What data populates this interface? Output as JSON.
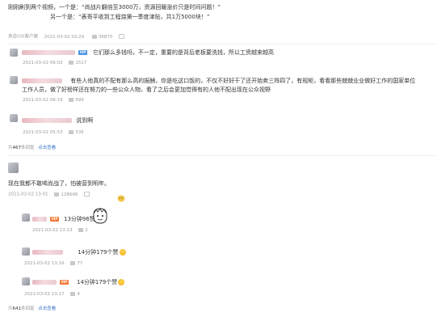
{
  "post": {
    "line1": "刚刚刷到两个视频，一个是：“尚战片翻倍至3000万，资源回暖涨价只是时间问题！”",
    "line2": "另一个是：“表哥平收到工程烧第一季度津贴，共1万5000块！”",
    "meta_left": "来自iOS客户端",
    "time": "2021-03-02 03:29",
    "likes": "36870"
  },
  "comments": [
    {
      "text": "它们那么多钱吗，不一定，重要的是背后老板要洗钱，所以工资越来越高",
      "time": "2021-03-02 06:02",
      "likes": "1517"
    },
    {
      "text": "有些人他真的不配有那么高的报酬，你是吃这口饭的，不仅不好好干了还开始卖三阵四了，有规矩，看看那些兢兢业业做好工作的国家单位",
      "text2": "工作人员，做了好榜样还在努力的一些公众人物，看了之后会更加觉得有的人他不配出现在公众视野",
      "time": "2021-03-02 06:19",
      "likes": "699"
    },
    {
      "text": "说到啊",
      "time": "2021-03-02 05:53",
      "likes": "535"
    }
  ],
  "thread1": {
    "count_prefix": "共",
    "count": "467",
    "count_suffix": "条回复",
    "view_more": "点击查看"
  },
  "second": {
    "text": "现在我都不敢喝肖战了，怕被营到明年。",
    "time": "2021-03-02 13:01",
    "likes": "128698"
  },
  "replies": [
    {
      "text": "13分钟96赞",
      "time": "2021-03-02 13:13",
      "likes": "2"
    },
    {
      "text": "14分钟179个赞",
      "time": "2021-03-02 13:16",
      "likes": "77"
    },
    {
      "text": "14分钟179个赞",
      "time": "2021-03-02 13:17",
      "likes": "4"
    }
  ],
  "thread2": {
    "count_prefix": "共",
    "count": "641",
    "count_suffix": "条回复",
    "view_more": "点击查看"
  },
  "colors": {
    "link": "#3a74c7",
    "badge": "#f47a3a",
    "meta": "#9a9a9a"
  },
  "icons": [
    "like-icon",
    "reply-icon",
    "more-icon",
    "avatar-image",
    "emoji-icon",
    "cartoon-face-image"
  ]
}
